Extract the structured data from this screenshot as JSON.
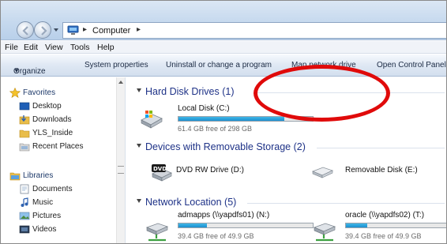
{
  "address_bar": {
    "path": [
      "Computer"
    ]
  },
  "menu": [
    "File",
    "Edit",
    "View",
    "Tools",
    "Help"
  ],
  "command_bar": {
    "organize": "Organize",
    "buttons": [
      "System properties",
      "Uninstall or change a program",
      "Map network drive",
      "Open Control Panel"
    ]
  },
  "nav_pane": {
    "favorites": {
      "label": "Favorites",
      "items": [
        "Desktop",
        "Downloads",
        "YLS_Inside",
        "Recent Places"
      ]
    },
    "libraries": {
      "label": "Libraries",
      "items": [
        "Documents",
        "Music",
        "Pictures",
        "Videos"
      ]
    }
  },
  "content": {
    "hard_disk": {
      "header": "Hard Disk Drives (1)",
      "drives": [
        {
          "name": "Local Disk (C:)",
          "free": "61.4 GB free of 298 GB",
          "used_fraction": 0.79
        }
      ]
    },
    "removable": {
      "header": "Devices with Removable Storage (2)",
      "devices": [
        "DVD RW Drive (D:)",
        "Removable Disk (E:)"
      ]
    },
    "network": {
      "header": "Network Location (5)",
      "drives": [
        {
          "name": "admapps (\\\\yapdfs01) (N:)",
          "free": "39.4 GB free of 49.9 GB",
          "used_fraction": 0.21
        },
        {
          "name": "oracle (\\\\yapdfs02) (T:)",
          "free": "39.4 GB free of 49.9 GB",
          "used_fraction": 0.21
        }
      ]
    }
  },
  "annotation": {
    "shape": "ellipse",
    "color": "#e00a0a"
  },
  "colors": {
    "header_text": "#1e3287",
    "bar_fill": "#1c8fcf",
    "annotation": "#e00a0a"
  }
}
